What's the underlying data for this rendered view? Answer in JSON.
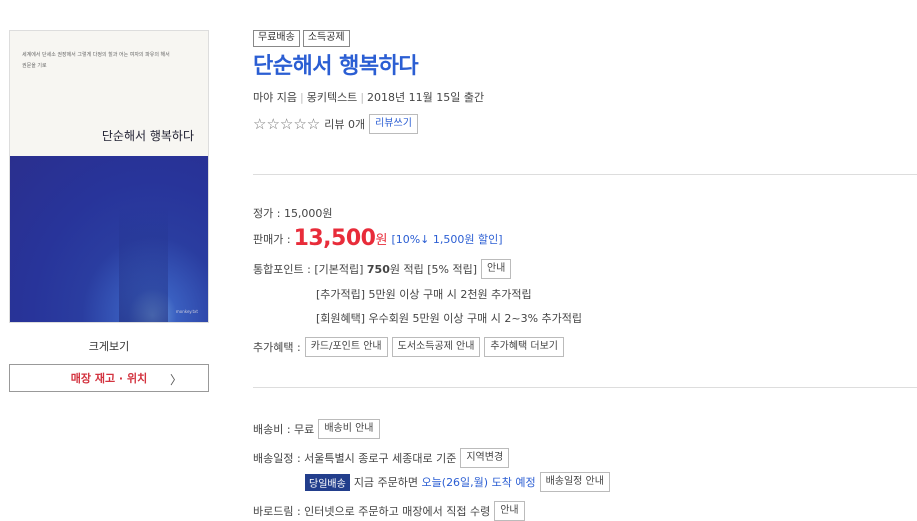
{
  "cover": {
    "small_line1": "세계에서 단세소 권장에서 그렇게 다정의 힐과 어는 여자의 파유의 해서",
    "small_line2": "권문을 기로",
    "title": "단순해서 행복하다",
    "publisher": "monkey.txt"
  },
  "left": {
    "zoom_label": "크게보기",
    "store_label": "매장 재고 · 위치",
    "store_chevron": "〉"
  },
  "badges": [
    "무료배송",
    "소득공제"
  ],
  "book": {
    "title": "단순해서 행복하다",
    "author": "마야 지음",
    "publisher": "몽키텍스트",
    "date": "2018년 11월 15일 출간",
    "stars": "☆☆☆☆☆",
    "review_count": "리뷰 0개",
    "review_write": "리뷰쓰기"
  },
  "price": {
    "list_price": "정가 : 15,000원",
    "sale_label": "판매가 :",
    "sale_value": "13,500",
    "sale_unit": "원",
    "discount": "[10%↓ 1,500원 할인]"
  },
  "points": {
    "label": "통합포인트 :",
    "basic_prefix": "[기본적립]",
    "basic_amount": "750",
    "basic_suffix": "원 적립 [5% 적립]",
    "info_btn": "안내",
    "extra": "[추가적립] 5만원 이상 구매 시 2천원 추가적립",
    "member": "[회원혜택] 우수회원 5만원 이상 구매 시 2~3% 추가적립"
  },
  "benefits": {
    "label": "추가혜택 :",
    "buttons": [
      "카드/포인트 안내",
      "도서소득공제 안내",
      "추가혜택 더보기"
    ]
  },
  "delivery": {
    "fee": "배송비 : 무료",
    "fee_btn": "배송비 안내",
    "schedule": "배송일정 : 서울특별시 종로구 세종대로 기준",
    "region_btn": "지역변경",
    "same_day": "당일배송",
    "order_now": "지금 주문하면",
    "arrival": "오늘(26일,월) 도착 예정",
    "schedule_btn": "배송일정 안내",
    "barodream": "바로드림 : 인터넷으로 주문하고 매장에서 직접 수령",
    "barodream_btn": "안내"
  },
  "colors": {
    "title": "#2b5ed3",
    "sale": "#e82c3a",
    "same_day_bg": "#223e8c"
  }
}
